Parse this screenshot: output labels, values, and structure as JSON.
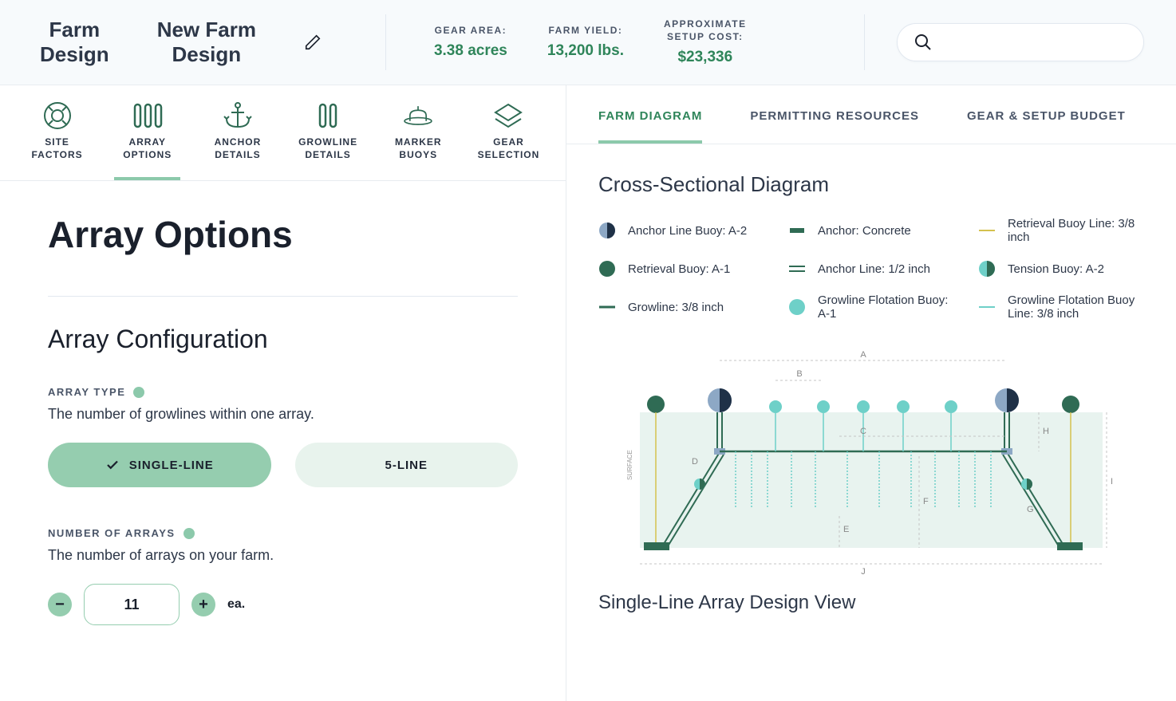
{
  "header": {
    "brand_line1": "Farm",
    "brand_line2": "Design",
    "design_name_line1": "New Farm",
    "design_name_line2": "Design",
    "stats": [
      {
        "label_line1": "GEAR AREA:",
        "label_line2": "",
        "value": "3.38 acres"
      },
      {
        "label_line1": "FARM YIELD:",
        "label_line2": "",
        "value": "13,200 lbs."
      },
      {
        "label_line1": "APPROXIMATE",
        "label_line2": "SETUP COST:",
        "value": "$23,336"
      }
    ]
  },
  "nav_tabs": [
    {
      "label_line1": "SITE",
      "label_line2": "FACTORS",
      "icon": "lifebuoy"
    },
    {
      "label_line1": "ARRAY",
      "label_line2": "OPTIONS",
      "icon": "array"
    },
    {
      "label_line1": "ANCHOR",
      "label_line2": "DETAILS",
      "icon": "anchor"
    },
    {
      "label_line1": "GROWLINE",
      "label_line2": "DETAILS",
      "icon": "growline"
    },
    {
      "label_line1": "MARKER",
      "label_line2": "BUOYS",
      "icon": "buoy"
    },
    {
      "label_line1": "GEAR",
      "label_line2": "SELECTION",
      "icon": "layers"
    }
  ],
  "page": {
    "title": "Array Options",
    "section_title": "Array Configuration",
    "array_type": {
      "label": "ARRAY TYPE",
      "desc": "The number of growlines within one array.",
      "option_single": "SINGLE-LINE",
      "option_five": "5-LINE"
    },
    "num_arrays": {
      "label": "NUMBER OF ARRAYS",
      "desc": "The number of arrays on your farm.",
      "value": "11",
      "suffix": "ea."
    }
  },
  "right_tabs": [
    "FARM DIAGRAM",
    "PERMITTING RESOURCES",
    "GEAR & SETUP BUDGET"
  ],
  "diagram": {
    "title": "Cross-Sectional Diagram",
    "subtitle": "Single-Line Array Design View",
    "legend": [
      {
        "swatch": "halfcircle-blue",
        "label": "Anchor Line Buoy: A-2"
      },
      {
        "swatch": "bar-darkgreen",
        "label": "Anchor: Concrete"
      },
      {
        "swatch": "line-yellow",
        "label": "Retrieval Buoy Line: 3/8 inch"
      },
      {
        "swatch": "circle-darkgreen",
        "label": "Retrieval Buoy: A-1"
      },
      {
        "swatch": "double-line",
        "label": "Anchor Line: 1/2 inch"
      },
      {
        "swatch": "halfcircle-teal",
        "label": "Tension Buoy: A-2"
      },
      {
        "swatch": "line-darkgreen",
        "label": "Growline: 3/8 inch"
      },
      {
        "swatch": "circle-teal",
        "label": "Growline Flotation Buoy: A-1"
      },
      {
        "swatch": "line-teal",
        "label": "Growline Flotation Buoy Line: 3/8 inch"
      }
    ],
    "dimension_labels": [
      "A",
      "B",
      "C",
      "D",
      "E",
      "F",
      "G",
      "H",
      "I",
      "J"
    ],
    "surface_label": "SURFACE"
  }
}
